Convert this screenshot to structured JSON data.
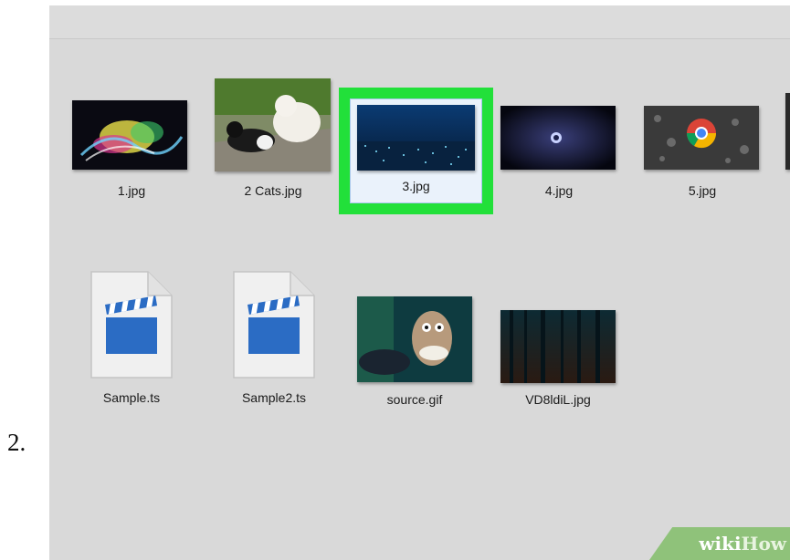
{
  "step_number": "2.",
  "files": [
    {
      "name": "1.jpg",
      "type": "image",
      "selected": false
    },
    {
      "name": "2 Cats.jpg",
      "type": "image",
      "selected": false
    },
    {
      "name": "3.jpg",
      "type": "image",
      "selected": true
    },
    {
      "name": "4.jpg",
      "type": "image",
      "selected": false
    },
    {
      "name": "5.jpg",
      "type": "image",
      "selected": false
    },
    {
      "name": "Sample.ts",
      "type": "video",
      "selected": false
    },
    {
      "name": "Sample2.ts",
      "type": "video",
      "selected": false
    },
    {
      "name": "source.gif",
      "type": "image",
      "selected": false
    },
    {
      "name": "VD8ldiL.jpg",
      "type": "image",
      "selected": false
    }
  ],
  "highlight_color": "#22e03a",
  "video_icon_color": "#2b6cc4",
  "watermark": {
    "wiki": "wiki",
    "how": "How"
  }
}
